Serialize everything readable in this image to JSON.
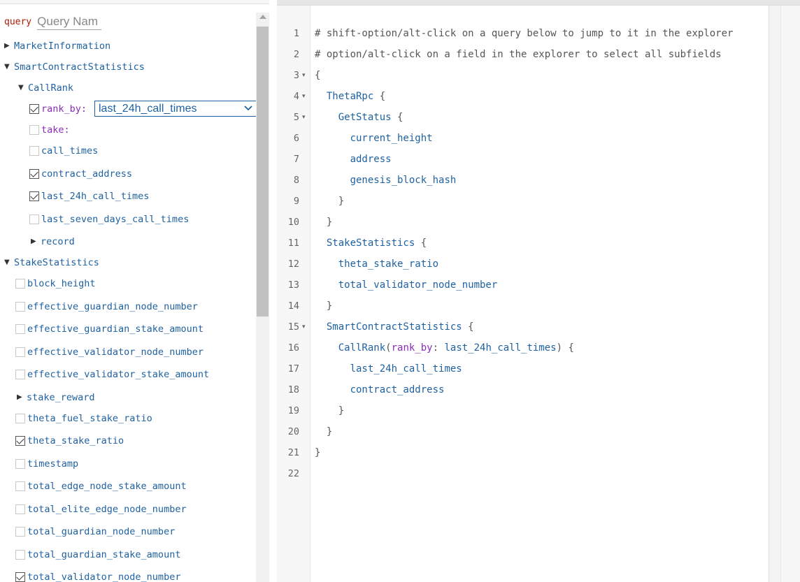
{
  "explorer": {
    "query_keyword": "query",
    "query_name_placeholder": "Query Nam",
    "tree": [
      {
        "kind": "type",
        "label": "MarketInformation",
        "expanded": false
      },
      {
        "kind": "type",
        "label": "SmartContractStatistics",
        "expanded": true
      },
      {
        "kind": "field",
        "label": "CallRank",
        "expanded": true
      },
      {
        "kind": "arg",
        "label": "rank_by:",
        "checked": true
      },
      {
        "kind": "arg",
        "label": "take:",
        "checked": false
      },
      {
        "kind": "leaf",
        "label": "call_times",
        "checked": false
      },
      {
        "kind": "leaf",
        "label": "contract_address",
        "checked": true
      },
      {
        "kind": "leaf",
        "label": "last_24h_call_times",
        "checked": true
      },
      {
        "kind": "leaf",
        "label": "last_seven_days_call_times",
        "checked": false
      },
      {
        "kind": "field",
        "label": "record",
        "expanded": false
      },
      {
        "kind": "type",
        "label": "StakeStatistics",
        "expanded": true
      },
      {
        "kind": "leaf",
        "label": "block_height",
        "checked": false
      },
      {
        "kind": "leaf",
        "label": "effective_guardian_node_number",
        "checked": false
      },
      {
        "kind": "leaf",
        "label": "effective_guardian_stake_amount",
        "checked": false
      },
      {
        "kind": "leaf",
        "label": "effective_validator_node_number",
        "checked": false
      },
      {
        "kind": "leaf",
        "label": "effective_validator_stake_amount",
        "checked": false
      },
      {
        "kind": "field",
        "label": "stake_reward",
        "expanded": false
      },
      {
        "kind": "leaf",
        "label": "theta_fuel_stake_ratio",
        "checked": false
      },
      {
        "kind": "leaf",
        "label": "theta_stake_ratio",
        "checked": true
      },
      {
        "kind": "leaf",
        "label": "timestamp",
        "checked": false
      },
      {
        "kind": "leaf",
        "label": "total_edge_node_stake_amount",
        "checked": false
      },
      {
        "kind": "leaf",
        "label": "total_elite_edge_node_number",
        "checked": false
      },
      {
        "kind": "leaf",
        "label": "total_guardian_node_number",
        "checked": false
      },
      {
        "kind": "leaf",
        "label": "total_guardian_stake_amount",
        "checked": false
      },
      {
        "kind": "leaf",
        "label": "total_validator_node_number",
        "checked": true
      }
    ],
    "rank_by_select": {
      "selected": "last_24h_call_times",
      "options": [
        "last_24h_call_times"
      ]
    }
  },
  "editor": {
    "lines": [
      {
        "n": "1",
        "fold": false,
        "tokens": [
          {
            "t": "comment",
            "v": "# shift-option/alt-click on a query below to jump to it in the explorer"
          }
        ]
      },
      {
        "n": "2",
        "fold": false,
        "tokens": [
          {
            "t": "comment",
            "v": "# option/alt-click on a field in the explorer to select all subfields"
          }
        ]
      },
      {
        "n": "3",
        "fold": true,
        "tokens": [
          {
            "t": "punct",
            "v": "{"
          }
        ]
      },
      {
        "n": "4",
        "fold": true,
        "tokens": [
          {
            "t": "punct",
            "v": "  "
          },
          {
            "t": "field",
            "v": "ThetaRpc"
          },
          {
            "t": "punct",
            "v": " {"
          }
        ]
      },
      {
        "n": "5",
        "fold": true,
        "tokens": [
          {
            "t": "punct",
            "v": "    "
          },
          {
            "t": "field",
            "v": "GetStatus"
          },
          {
            "t": "punct",
            "v": " {"
          }
        ]
      },
      {
        "n": "6",
        "fold": false,
        "tokens": [
          {
            "t": "punct",
            "v": "      "
          },
          {
            "t": "field",
            "v": "current_height"
          }
        ]
      },
      {
        "n": "7",
        "fold": false,
        "tokens": [
          {
            "t": "punct",
            "v": "      "
          },
          {
            "t": "field",
            "v": "address"
          }
        ]
      },
      {
        "n": "8",
        "fold": false,
        "tokens": [
          {
            "t": "punct",
            "v": "      "
          },
          {
            "t": "field",
            "v": "genesis_block_hash"
          }
        ]
      },
      {
        "n": "9",
        "fold": false,
        "tokens": [
          {
            "t": "punct",
            "v": "    }"
          }
        ]
      },
      {
        "n": "10",
        "fold": false,
        "tokens": [
          {
            "t": "punct",
            "v": "  }"
          }
        ]
      },
      {
        "n": "11",
        "fold": false,
        "tokens": [
          {
            "t": "punct",
            "v": "  "
          },
          {
            "t": "field",
            "v": "StakeStatistics"
          },
          {
            "t": "punct",
            "v": " {"
          }
        ]
      },
      {
        "n": "12",
        "fold": false,
        "tokens": [
          {
            "t": "punct",
            "v": "    "
          },
          {
            "t": "field",
            "v": "theta_stake_ratio"
          }
        ]
      },
      {
        "n": "13",
        "fold": false,
        "tokens": [
          {
            "t": "punct",
            "v": "    "
          },
          {
            "t": "field",
            "v": "total_validator_node_number"
          }
        ]
      },
      {
        "n": "14",
        "fold": false,
        "tokens": [
          {
            "t": "punct",
            "v": "  }"
          }
        ]
      },
      {
        "n": "15",
        "fold": true,
        "tokens": [
          {
            "t": "punct",
            "v": "  "
          },
          {
            "t": "field",
            "v": "SmartContractStatistics"
          },
          {
            "t": "punct",
            "v": " {"
          }
        ]
      },
      {
        "n": "16",
        "fold": false,
        "tokens": [
          {
            "t": "punct",
            "v": "    "
          },
          {
            "t": "field",
            "v": "CallRank"
          },
          {
            "t": "punct",
            "v": "("
          },
          {
            "t": "arg",
            "v": "rank_by"
          },
          {
            "t": "punct",
            "v": ": "
          },
          {
            "t": "val",
            "v": "last_24h_call_times"
          },
          {
            "t": "punct",
            "v": ") {"
          }
        ]
      },
      {
        "n": "17",
        "fold": false,
        "tokens": [
          {
            "t": "punct",
            "v": "      "
          },
          {
            "t": "field",
            "v": "last_24h_call_times"
          }
        ]
      },
      {
        "n": "18",
        "fold": false,
        "tokens": [
          {
            "t": "punct",
            "v": "      "
          },
          {
            "t": "field",
            "v": "contract_address"
          }
        ]
      },
      {
        "n": "19",
        "fold": false,
        "tokens": [
          {
            "t": "punct",
            "v": "    }"
          }
        ]
      },
      {
        "n": "20",
        "fold": false,
        "tokens": [
          {
            "t": "punct",
            "v": "  }"
          }
        ]
      },
      {
        "n": "21",
        "fold": false,
        "tokens": [
          {
            "t": "punct",
            "v": "}"
          }
        ]
      },
      {
        "n": "22",
        "fold": false,
        "tokens": []
      }
    ]
  },
  "colors": {
    "keyword": "#b11a04",
    "field": "#1f61a0",
    "argument": "#8b2bb9",
    "comment": "#555555"
  }
}
